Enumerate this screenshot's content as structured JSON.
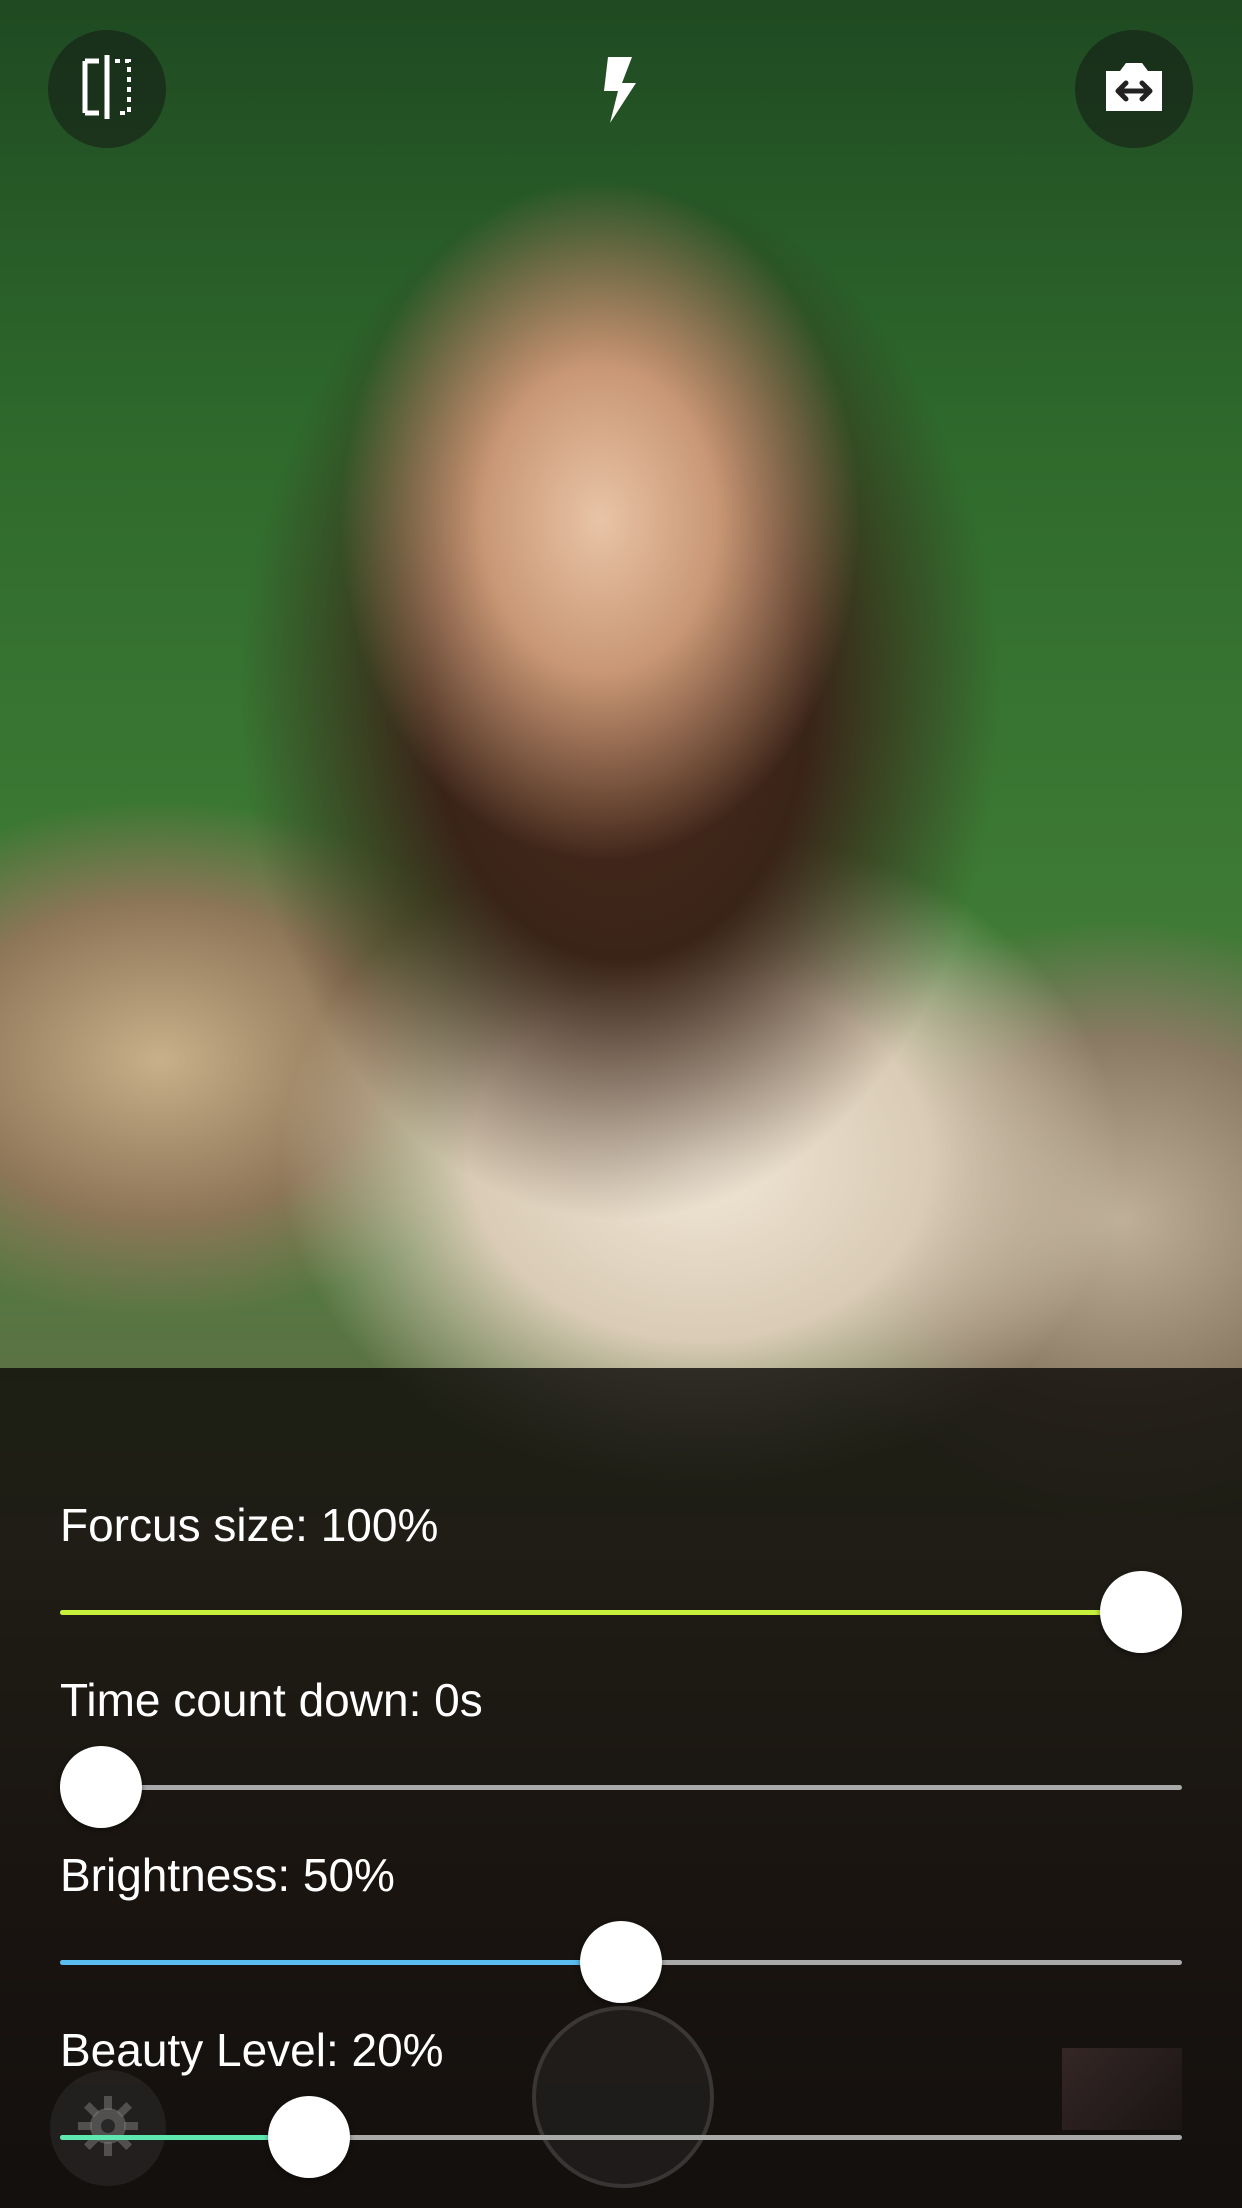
{
  "top_bar": {
    "left_icon": "split-compare-icon",
    "center_icon": "flash-icon",
    "right_icon": "switch-camera-icon"
  },
  "sliders": [
    {
      "label": "Forcus size: 100%",
      "level_percent": 100,
      "fill_color": "#c6f03c"
    },
    {
      "label": "Time count down: 0s",
      "level_percent": 0,
      "fill_color": "#a9a9a9"
    },
    {
      "label": "Brightness: 50%",
      "level_percent": 50,
      "fill_color": "#5bbcf0"
    },
    {
      "label": "Beauty Level: 20%",
      "level_percent": 20,
      "fill_color": "#5ee8b0"
    }
  ],
  "bottom_bar": {
    "left_icon": "gear-icon",
    "center_control": "shutter-button",
    "right_control": "gallery-thumbnail"
  }
}
